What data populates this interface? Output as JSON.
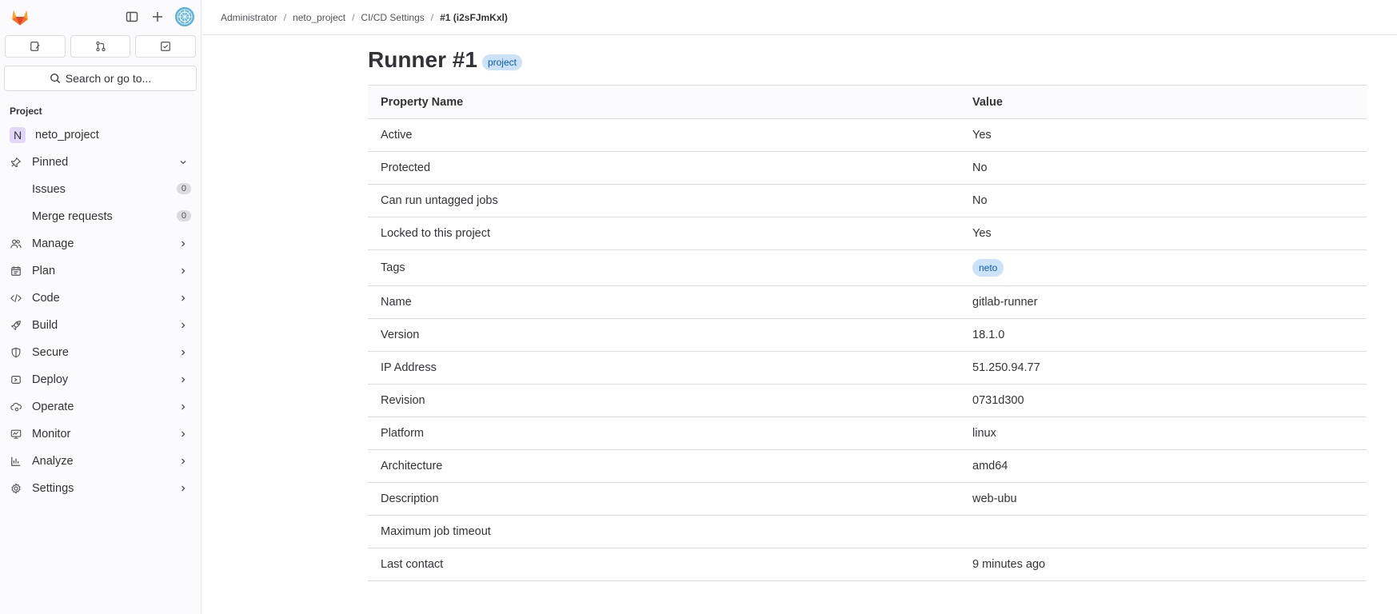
{
  "sidebar": {
    "search_label": "Search or go to...",
    "section_label": "Project",
    "project": {
      "initial": "N",
      "name": "neto_project"
    },
    "pinned": {
      "label": "Pinned",
      "items": [
        {
          "label": "Issues",
          "count": "0"
        },
        {
          "label": "Merge requests",
          "count": "0"
        }
      ]
    },
    "items": [
      {
        "label": "Manage",
        "icon": "users-icon"
      },
      {
        "label": "Plan",
        "icon": "planning-icon"
      },
      {
        "label": "Code",
        "icon": "code-icon"
      },
      {
        "label": "Build",
        "icon": "rocket-icon"
      },
      {
        "label": "Secure",
        "icon": "shield-icon"
      },
      {
        "label": "Deploy",
        "icon": "deployments-icon"
      },
      {
        "label": "Operate",
        "icon": "cloud-gear-icon"
      },
      {
        "label": "Monitor",
        "icon": "monitor-icon"
      },
      {
        "label": "Analyze",
        "icon": "chart-icon"
      },
      {
        "label": "Settings",
        "icon": "gear-icon"
      }
    ]
  },
  "breadcrumb": [
    "Administrator",
    "neto_project",
    "CI/CD Settings",
    "#1 (i2sFJmKxl)"
  ],
  "page": {
    "title": "Runner #1",
    "badge": "project"
  },
  "table": {
    "headers": [
      "Property Name",
      "Value"
    ],
    "rows": [
      {
        "name": "Active",
        "value": "Yes"
      },
      {
        "name": "Protected",
        "value": "No"
      },
      {
        "name": "Can run untagged jobs",
        "value": "No"
      },
      {
        "name": "Locked to this project",
        "value": "Yes"
      },
      {
        "name": "Tags",
        "value": "neto"
      },
      {
        "name": "Name",
        "value": "gitlab-runner"
      },
      {
        "name": "Version",
        "value": "18.1.0"
      },
      {
        "name": "IP Address",
        "value": "51.250.94.77"
      },
      {
        "name": "Revision",
        "value": "0731d300"
      },
      {
        "name": "Platform",
        "value": "linux"
      },
      {
        "name": "Architecture",
        "value": "amd64"
      },
      {
        "name": "Description",
        "value": "web-ubu"
      },
      {
        "name": "Maximum job timeout",
        "value": ""
      },
      {
        "name": "Last contact",
        "value": "9 minutes ago"
      }
    ]
  }
}
